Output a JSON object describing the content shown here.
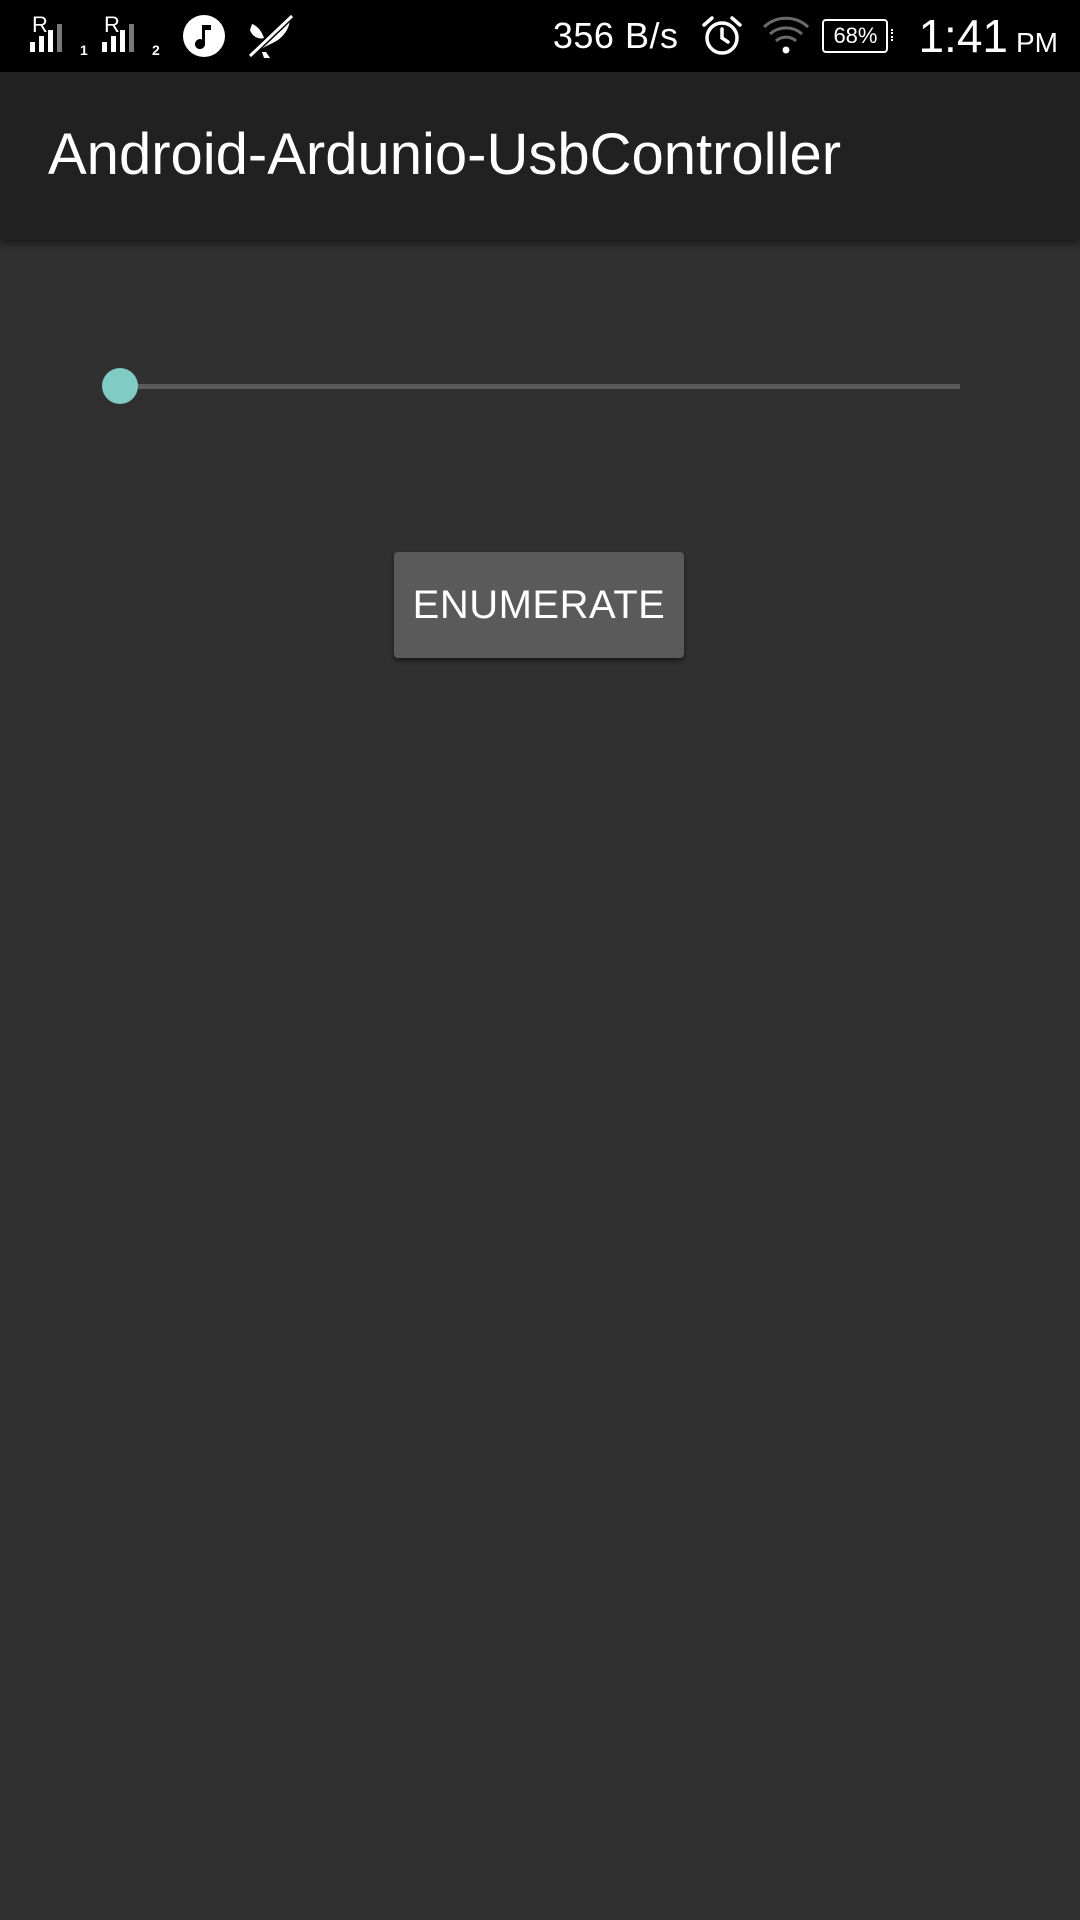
{
  "status_bar": {
    "sim1_indicator": "R",
    "sim1_index": "1",
    "sim2_indicator": "R",
    "sim2_index": "2",
    "notification_icons": [
      "music-icon",
      "mute-icon"
    ],
    "network_speed": "356 B/s",
    "status_icons": [
      "alarm-icon",
      "wifi-icon"
    ],
    "battery_percent": "68%",
    "time": "1:41",
    "ampm": "PM"
  },
  "app_bar": {
    "title": "Android-Ardunio-UsbController"
  },
  "main": {
    "seekbar": {
      "progress_fraction": 0,
      "accent_color": "#80cbc4"
    },
    "enumerate_button": {
      "label": "ENUMERATE"
    }
  },
  "colors": {
    "background": "#303030",
    "app_bar": "#212121",
    "status_bar": "#000000",
    "accent": "#80cbc4",
    "button": "#5a5a5a"
  }
}
